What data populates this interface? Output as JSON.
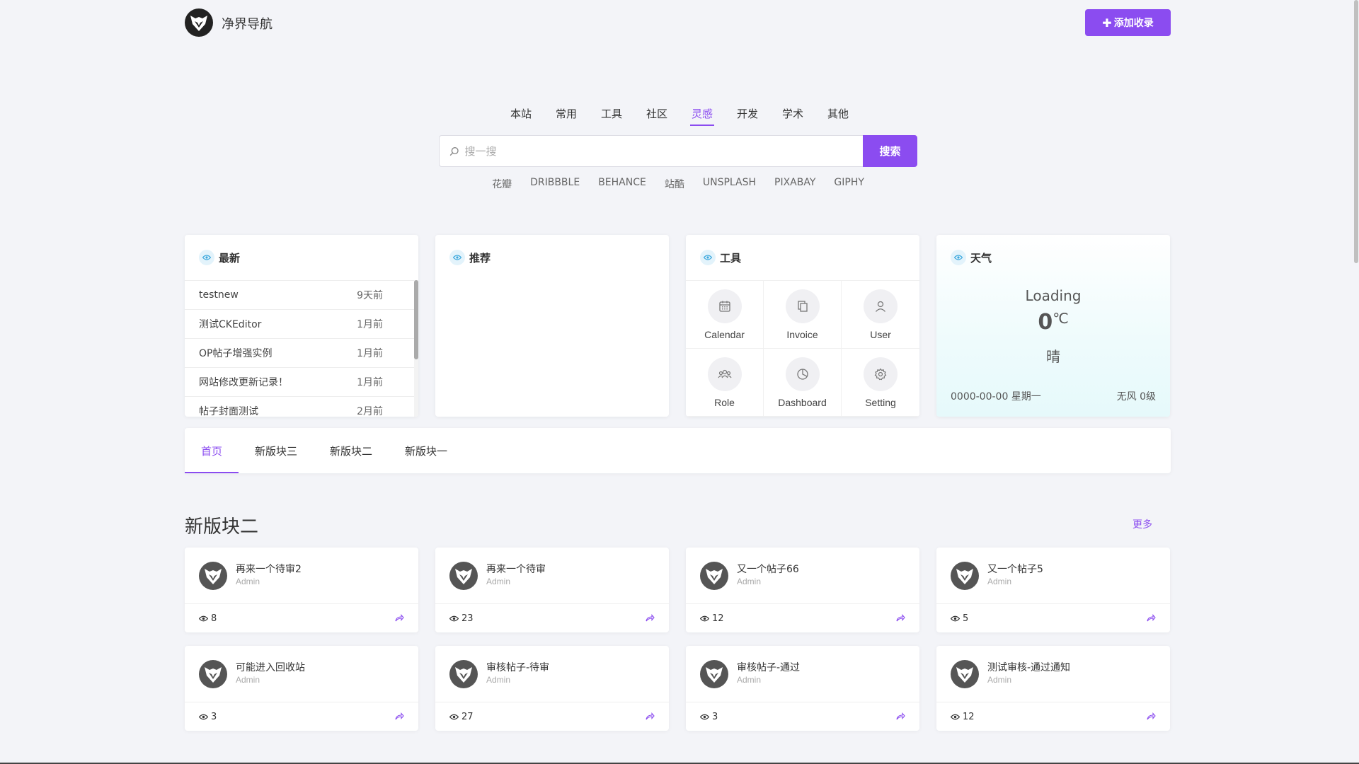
{
  "header": {
    "site_title": "净界导航",
    "add_button_label": "添加收录"
  },
  "search": {
    "tabs": [
      "本站",
      "常用",
      "工具",
      "社区",
      "灵感",
      "开发",
      "学术",
      "其他"
    ],
    "active_tab": "灵感",
    "placeholder": "搜一搜",
    "button_label": "搜索",
    "engines": [
      "花瓣",
      "DRIBBBLE",
      "BEHANCE",
      "站酷",
      "UNSPLASH",
      "PIXABAY",
      "GIPHY"
    ]
  },
  "latest": {
    "title": "最新",
    "items": [
      {
        "title": "testnew",
        "time": "9天前"
      },
      {
        "title": "测试CKEditor",
        "time": "1月前"
      },
      {
        "title": "OP帖子增强实例",
        "time": "1月前"
      },
      {
        "title": "网站修改更新记录！",
        "time": "1月前"
      },
      {
        "title": "帖子封面测试",
        "time": "2月前"
      }
    ]
  },
  "recommend": {
    "title": "推荐"
  },
  "tools": {
    "title": "工具",
    "items": [
      {
        "label": "Calendar",
        "icon": "calendar-icon"
      },
      {
        "label": "Invoice",
        "icon": "copy-icon"
      },
      {
        "label": "User",
        "icon": "user-icon"
      },
      {
        "label": "Role",
        "icon": "users-icon"
      },
      {
        "label": "Dashboard",
        "icon": "pie-chart-icon"
      },
      {
        "label": "Setting",
        "icon": "gear-icon"
      }
    ]
  },
  "weather": {
    "title": "天气",
    "status": "Loading",
    "temperature": "0",
    "unit": "℃",
    "condition": "晴",
    "date": "0000-00-00 星期一",
    "wind": "无风 0级"
  },
  "section_tabs": {
    "items": [
      "首页",
      "新版块三",
      "新版块二",
      "新版块一"
    ],
    "active": "首页"
  },
  "section": {
    "title": "新版块二",
    "more_label": "更多",
    "posts": [
      {
        "title": "再来一个待审2",
        "author": "Admin",
        "views": "8"
      },
      {
        "title": "再来一个待审",
        "author": "Admin",
        "views": "23"
      },
      {
        "title": "又一个帖子66",
        "author": "Admin",
        "views": "12"
      },
      {
        "title": "又一个帖子5",
        "author": "Admin",
        "views": "5"
      },
      {
        "title": "可能进入回收站",
        "author": "Admin",
        "views": "3"
      },
      {
        "title": "审核帖子-待审",
        "author": "Admin",
        "views": "27"
      },
      {
        "title": "审核帖子-通过",
        "author": "Admin",
        "views": "3"
      },
      {
        "title": "测试审核-通过通知",
        "author": "Admin",
        "views": "12"
      }
    ]
  },
  "colors": {
    "accent": "#8b4cf0",
    "background": "#f3f4f8"
  }
}
